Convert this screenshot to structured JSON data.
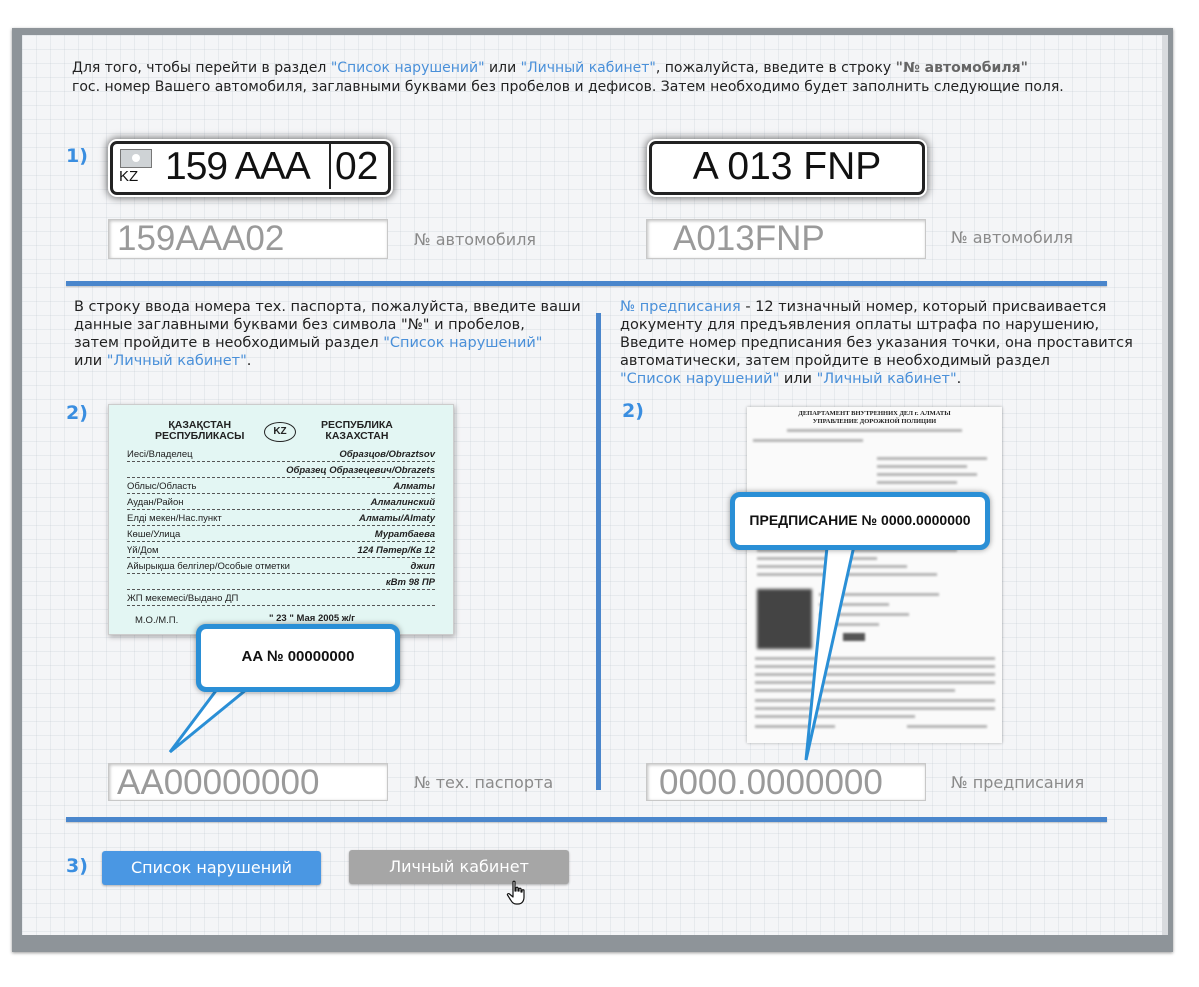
{
  "intro": {
    "p1": "Для того, чтобы перейти в раздел ",
    "link1": "\"Список нарушений\"",
    "p2": " или ",
    "link2": "\"Личный кабинет\"",
    "p3": ", пожалуйста, введите в строку ",
    "field": "\"№ автомобиля\"",
    "line2": "гос. номер Вашего автомобиля, заглавными буквами без пробелов и дефисов.  Затем необходимо будет заполнить следующие поля."
  },
  "steps": {
    "s1": "1)",
    "s2a": "2)",
    "s2b": "2)",
    "s3": "3)"
  },
  "plate1": {
    "country": "KZ",
    "number": "159 AAA",
    "region": "02"
  },
  "plate2": {
    "number": "A 013 FNP"
  },
  "car_inputs": [
    {
      "value": "159AAA02",
      "label": "№ автомобиля"
    },
    {
      "value": "A013FNP",
      "label": "№ автомобиля"
    }
  ],
  "passport_section": {
    "p1": "В строку ввода номера тех. паспорта, пожалуйста, введите ваши",
    "p2": "данные заглавными буквами без символа \"№\" и пробелов,",
    "p3": "затем пройдите в необходимый раздел ",
    "link1": "\"Список нарушений\"",
    "p4": "или ",
    "link2": "\"Личный кабинет\"",
    "p5": ".",
    "input_value": "AA00000000",
    "input_label": "№ тех. паспорта",
    "bubble": "AA № 00000000"
  },
  "passport_card": {
    "left_title": "ҚАЗАҚСТАН\nРЕСПУБЛИКАСЫ",
    "badge": "KZ",
    "right_title": "РЕСПУБЛИКА\nКАЗАХСТАН",
    "rows": [
      {
        "k": "Иесі/Владелец",
        "v": "Образцов/Obraztsov"
      },
      {
        "k": "",
        "v": "Образец Образецевич/Obrazets"
      },
      {
        "k": "Облыс/Область",
        "v": "Алматы"
      },
      {
        "k": "Аудан/Район",
        "v": "Алмалинский"
      },
      {
        "k": "Елді мекен/Нас.пункт",
        "v": "Алматы/Almaty"
      },
      {
        "k": "Көше/Улица",
        "v": "Муратбаева"
      },
      {
        "k": "Үй/Дом",
        "v": "124 Пәтер/Кв 12"
      },
      {
        "k": "Айырықша белгілер/Особые отметки",
        "v": "джип"
      },
      {
        "k": "",
        "v": "кВт 98 ПР"
      },
      {
        "k": "ЖП мекемесі/Выдано ДП",
        "v": ""
      }
    ],
    "mp": "М.О./М.П.",
    "date": "\" 23 \"   Мая   2005  ж/г",
    "number": "AA № 00000000"
  },
  "order_section": {
    "link0": "№ предписания",
    "p1": " - 12 тизначный номер,  который присваивается",
    "p2": "документу для предъявления оплаты штрафа по нарушению,",
    "p3": "Введите номер предписания без указания точки, она проставится",
    "p4": "автоматически, затем пройдите в необходимый раздел",
    "link1": "\"Список нарушений\"",
    "p5": " или ",
    "link2": "\"Личный кабинет\"",
    "p6": ".",
    "input_value": "0000.0000000",
    "input_label": "№ предписания",
    "bubble": "ПРЕДПИСАНИЕ № 0000.0000000"
  },
  "order_doc": {
    "head1": "ДЕПАРТАМЕНТ ВНУТРЕННИХ ДЕЛ г. АЛМАТЫ",
    "head2": "УПРАВЛЕНИЕ ДОРОЖНОЙ ПОЛИЦИИ"
  },
  "buttons": {
    "violations": "Список нарушений",
    "cabinet": "Личный кабинет"
  },
  "colors": {
    "accent": "#4a86cc",
    "link": "#4a90d9",
    "button_blue": "#4a97e3",
    "button_gray": "#a6a6a6"
  }
}
